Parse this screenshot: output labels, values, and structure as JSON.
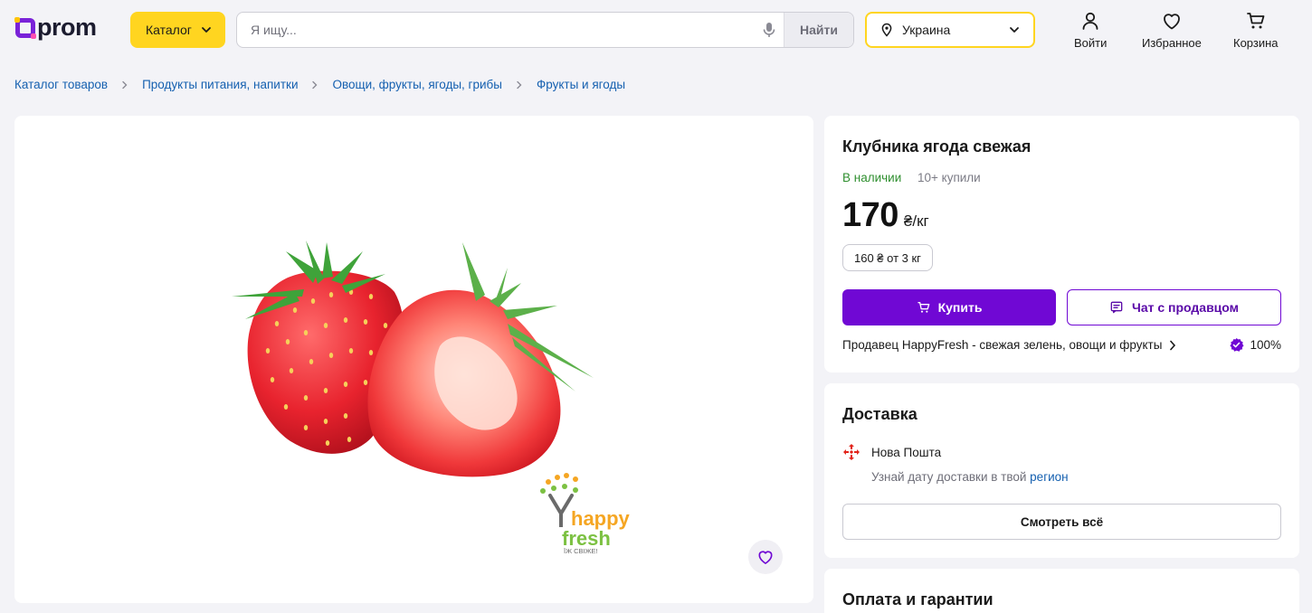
{
  "header": {
    "logo_text": "prom",
    "catalog_label": "Каталог",
    "search": {
      "placeholder": "Я ищу...",
      "value": "",
      "button_label": "Найти"
    },
    "region_label": "Украина",
    "icons": [
      {
        "name": "user-icon",
        "label": "Войти"
      },
      {
        "name": "heart-icon",
        "label": "Избранное"
      },
      {
        "name": "cart-icon",
        "label": "Корзина"
      }
    ]
  },
  "breadcrumb": [
    "Каталог товаров",
    "Продукты питания, напитки",
    "Овощи, фрукты, ягоды, грибы",
    "Фрукты и ягоды"
  ],
  "product": {
    "title": "Клубника ягода свежая",
    "stock_status": "В наличии",
    "bought_count": "10+ купили",
    "price": "170",
    "price_unit": "₴/кг",
    "wholesale_price": "160 ₴ от 3 кг",
    "buy_label": "Купить",
    "chat_label": "Чат с продавцом",
    "seller_label": "Продавец HappyFresh - свежая зелень, овощи и фрукты",
    "seller_rating": "100%",
    "image_brand": {
      "line1": "happy",
      "line2": "fresh",
      "tagline": "ЇЖ СВІЖЕ!"
    }
  },
  "delivery": {
    "title": "Доставка",
    "carrier": "Нова Пошта",
    "hint_text": "Узнай дату доставки в твой",
    "hint_link": "регион",
    "see_all_label": "Смотреть всё"
  },
  "payment": {
    "title": "Оплата и гарантии"
  },
  "colors": {
    "accent_purple": "#7008d4",
    "catalog_yellow": "#ffd520",
    "link_blue": "#1560b0",
    "stock_green": "#2f8f2f"
  }
}
